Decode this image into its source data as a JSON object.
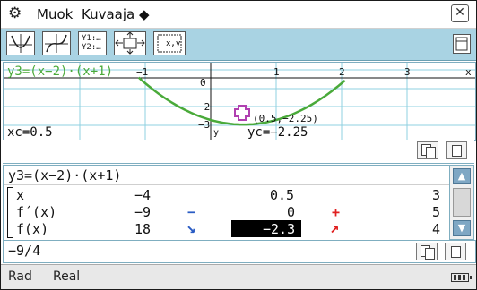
{
  "menubar": {
    "settings_icon": "gear-icon",
    "edit_label": "Muok",
    "graph_label": "Kuvaaja ◆",
    "close_icon": "close-icon"
  },
  "toolbar": {
    "y1y2_line1": "Y1:…",
    "y1y2_line2": "Y2:…"
  },
  "graph": {
    "function_label": "y3=(x−2)·(x+1)",
    "x_tick_labels": [
      "−1",
      "0",
      "1",
      "2",
      "3"
    ],
    "y_tick_labels": [
      "−2",
      "−3"
    ],
    "x_axis_label": "x",
    "y_axis_label": "y",
    "point_label": "(0.5,−2.25)",
    "xc_readout": "xc=0.5",
    "yc_readout": "yc=−2.25",
    "curve_color": "#4aaa3a",
    "marker_color": "#b040b0"
  },
  "table": {
    "expression": "y3=(x−2)·(x+1)",
    "rows": [
      {
        "label": "x",
        "c1": "−4",
        "c2_sign": "",
        "c3": "0.5",
        "c4_sign": "",
        "c5": "3"
      },
      {
        "label": "f´(x)",
        "c1": "−9",
        "c2_sign": "−",
        "c3": "0",
        "c4_sign": "+",
        "c5": "5"
      },
      {
        "label": "f(x)",
        "c1": "18",
        "c2_sign": "↘",
        "c3": "−2.3",
        "c4_sign": "↗",
        "c5": "4"
      }
    ]
  },
  "edit_line": {
    "value": "−9/4"
  },
  "status": {
    "angle": "Rad",
    "mode": "Real",
    "battery_icon": "battery-icon"
  }
}
